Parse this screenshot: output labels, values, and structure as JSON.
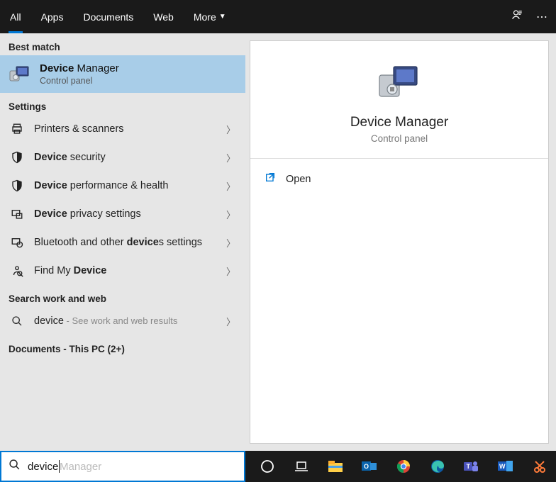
{
  "tabs": {
    "all": "All",
    "apps": "Apps",
    "documents": "Documents",
    "web": "Web",
    "more": "More"
  },
  "sections": {
    "best_match": "Best match",
    "settings": "Settings",
    "search_web": "Search work and web",
    "documents_pc": "Documents - This PC (2+)"
  },
  "best_match": {
    "title_bold": "Device",
    "title_rest": " Manager",
    "subtitle": "Control panel"
  },
  "settings_list": [
    {
      "icon": "printer",
      "pre": "Printers & scanners",
      "bold": "",
      "post": ""
    },
    {
      "icon": "shield",
      "pre": "",
      "bold": "Device",
      "post": " security"
    },
    {
      "icon": "shield",
      "pre": "",
      "bold": "Device",
      "post": " performance & health"
    },
    {
      "icon": "privacy",
      "pre": "",
      "bold": "Device",
      "post": " privacy settings"
    },
    {
      "icon": "bt",
      "pre": "Bluetooth and other ",
      "bold": "device",
      "post": "s settings"
    },
    {
      "icon": "find",
      "pre": "Find My ",
      "bold": "Device",
      "post": ""
    }
  ],
  "web_item": {
    "term": "device",
    "sub": " - See work and web results"
  },
  "preview": {
    "title": "Device Manager",
    "subtitle": "Control panel",
    "open": "Open"
  },
  "search": {
    "value": "device",
    "ghost": " Manager"
  }
}
